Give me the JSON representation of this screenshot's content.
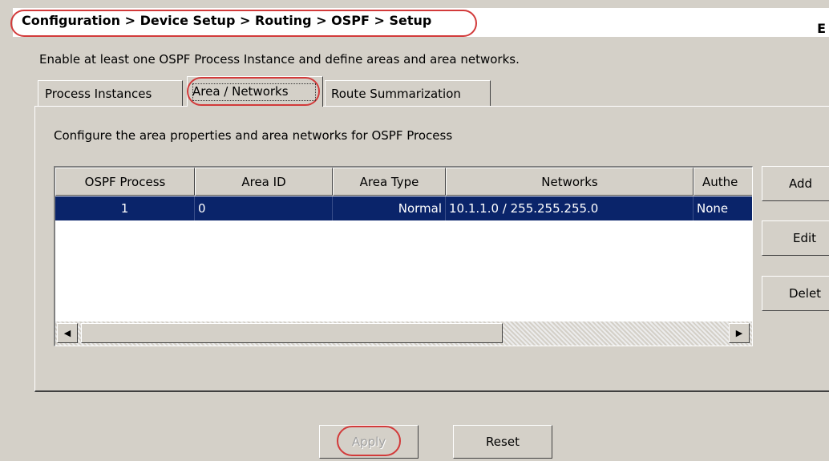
{
  "breadcrumb": "Configuration > Device Setup > Routing > OSPF > Setup",
  "breadcrumb_edge": "E",
  "instruction": "Enable at least one OSPF Process Instance and define areas and area networks.",
  "tabs": [
    {
      "label": "Process Instances"
    },
    {
      "label": "Area / Networks"
    },
    {
      "label": "Route Summarization"
    }
  ],
  "panel_description": "Configure the area properties and area networks for OSPF Process",
  "table": {
    "columns": [
      "OSPF Process",
      "Area ID",
      "Area Type",
      "Networks",
      "Authe"
    ],
    "rows": [
      {
        "ospf_process": "1",
        "area_id": "0",
        "area_type": "Normal",
        "networks": "10.1.1.0 / 255.255.255.0",
        "auth": "None"
      }
    ]
  },
  "side_buttons": {
    "add": "Add",
    "edit": "Edit",
    "delete": "Delet"
  },
  "buttons": {
    "apply": "Apply",
    "reset": "Reset"
  },
  "scroll": {
    "left_arrow": "◀",
    "right_arrow": "▶"
  },
  "colors": {
    "highlight_oval": "#d23a3a",
    "selected_row": "#0a246a"
  }
}
